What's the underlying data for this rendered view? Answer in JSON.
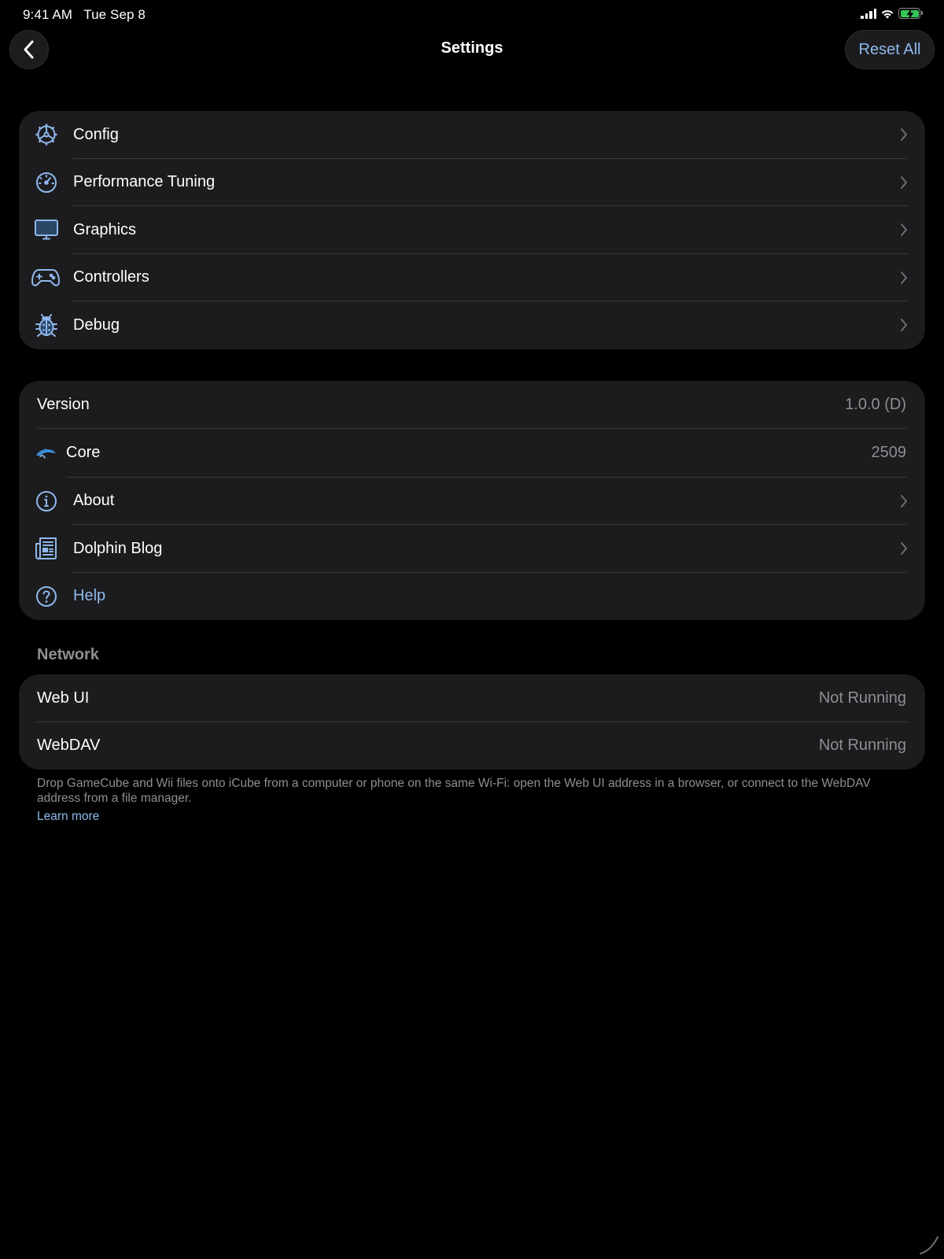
{
  "status_bar": {
    "time_date": "9:41 AM   Tue Sep 8",
    "icons": [
      "cellular-signal-icon",
      "wifi-icon",
      "battery-charging-icon"
    ],
    "battery_color": "#34c759"
  },
  "nav": {
    "back_icon": "chevron-left-icon",
    "title": "Settings",
    "reset_label": "Reset All"
  },
  "settings_group": {
    "items": [
      {
        "label": "Config",
        "icon": "gear-steering-icon"
      },
      {
        "label": "Performance Tuning",
        "icon": "speedometer-icon"
      },
      {
        "label": "Graphics",
        "icon": "display-icon"
      },
      {
        "label": "Controllers",
        "icon": "gamepad-icon"
      },
      {
        "label": "Debug",
        "icon": "ladybug-icon"
      }
    ]
  },
  "info_group": {
    "version": {
      "label": "Version",
      "value": "1.0.0 (D)"
    },
    "core": {
      "label": "Core",
      "value": "2509",
      "icon": "dolphin-icon"
    },
    "about": {
      "label": "About",
      "icon": "info-circle-icon"
    },
    "blog": {
      "label": "Dolphin Blog",
      "icon": "newspaper-icon"
    },
    "help": {
      "label": "Help",
      "icon": "question-circle-icon"
    }
  },
  "network": {
    "header": "Network",
    "web_ui": {
      "label": "Web UI",
      "value": "Not Running"
    },
    "webdav": {
      "label": "WebDAV",
      "value": "Not Running"
    },
    "footer": "Drop GameCube and Wii files onto iCube from a computer or phone on the same Wi-Fi: open the Web UI address in a browser, or connect to the WebDAV address from a file manager.",
    "learn_more": "Learn more"
  },
  "colors": {
    "accent": "#8fb8ec",
    "card_bg": "#1c1c1e",
    "secondary_text": "#8e8e93",
    "separator": "#3a3a3c"
  }
}
